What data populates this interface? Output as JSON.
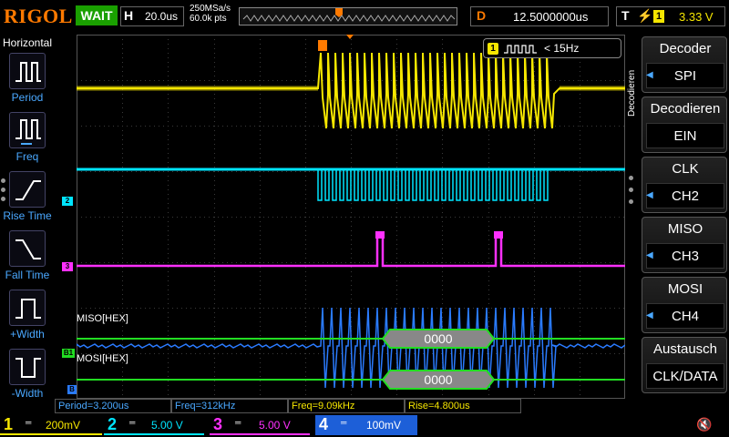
{
  "header": {
    "brand": "RIGOL",
    "run_status": "WAIT",
    "horizontal": {
      "label": "H",
      "timebase": "20.0us"
    },
    "sample_rate": "250MSa/s",
    "memory_depth": "60.0k pts",
    "delay": {
      "label": "D",
      "value": "12.5000000us"
    },
    "trigger": {
      "label": "T",
      "source": "1",
      "level": "3.33 V"
    }
  },
  "left_panel": {
    "title": "Horizontal",
    "measurements": [
      {
        "label": "Period"
      },
      {
        "label": "Freq"
      },
      {
        "label": "Rise Time"
      },
      {
        "label": "Fall Time"
      },
      {
        "label": "+Width"
      },
      {
        "label": "-Width"
      }
    ]
  },
  "display": {
    "freq_counter": "< 15Hz",
    "channel_markers": {
      "ch2": "2",
      "ch3": "3",
      "b1": "B1",
      "b2": "B"
    },
    "bus": {
      "miso_label": "MISO[HEX]",
      "mosi_label": "MOSI[HEX]",
      "miso_value": "0000",
      "mosi_value": "0000"
    }
  },
  "right_panel": {
    "vertical_tab": "Decodieren",
    "buttons": [
      {
        "title": "Decoder",
        "value": "SPI"
      },
      {
        "title": "Decodieren",
        "value": "EIN"
      },
      {
        "title": "CLK",
        "value": "CH2"
      },
      {
        "title": "MISO",
        "value": "CH3"
      },
      {
        "title": "MOSI",
        "value": "CH4"
      },
      {
        "title": "Austausch",
        "value": "CLK/DATA"
      }
    ]
  },
  "measurement_strip": {
    "period": "Period=3.200us",
    "freq": "Freq=312kHz",
    "freq2": "Freq=9.09kHz",
    "rise": "Rise=4.800us"
  },
  "channels": [
    {
      "num": "1",
      "scale": "200mV",
      "color": "#f5e600"
    },
    {
      "num": "2",
      "scale": "5.00 V",
      "color": "#00e5ff"
    },
    {
      "num": "3",
      "scale": "5.00 V",
      "color": "#ff30ff"
    },
    {
      "num": "4",
      "scale": "100mV",
      "color": "#2a7bff"
    }
  ],
  "colors": {
    "brand": "#ff7a00",
    "ch1": "#f5e600",
    "ch2": "#00e5ff",
    "ch3": "#ff30ff",
    "ch4": "#2a7bff",
    "bus": "#22dd22",
    "accent": "#4aa8ff"
  }
}
